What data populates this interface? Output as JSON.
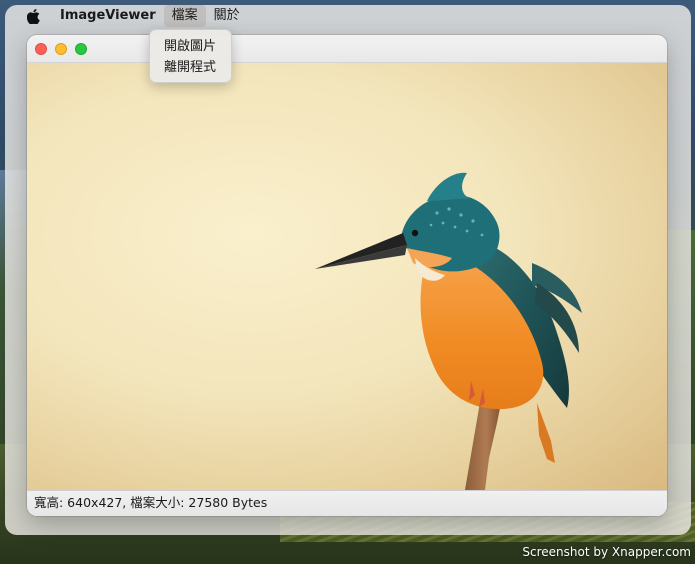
{
  "menubar": {
    "apple_icon": "apple-logo-icon",
    "app_name": "ImageViewer",
    "items": [
      {
        "label": "檔案",
        "active": true
      },
      {
        "label": "關於",
        "active": false
      }
    ]
  },
  "file_menu": {
    "items": [
      {
        "label": "開啟圖片"
      },
      {
        "label": "離開程式"
      }
    ]
  },
  "window": {
    "buttons": {
      "close_color": "#fe5f57",
      "minimize_color": "#febc2e",
      "zoom_color": "#28c840"
    },
    "image": {
      "subject": "kingfisher-bird-on-branch-photo"
    },
    "status": "寬高: 640x427, 檔案大小: 27580 Bytes"
  },
  "watermark": "Screenshot by Xnapper.com"
}
